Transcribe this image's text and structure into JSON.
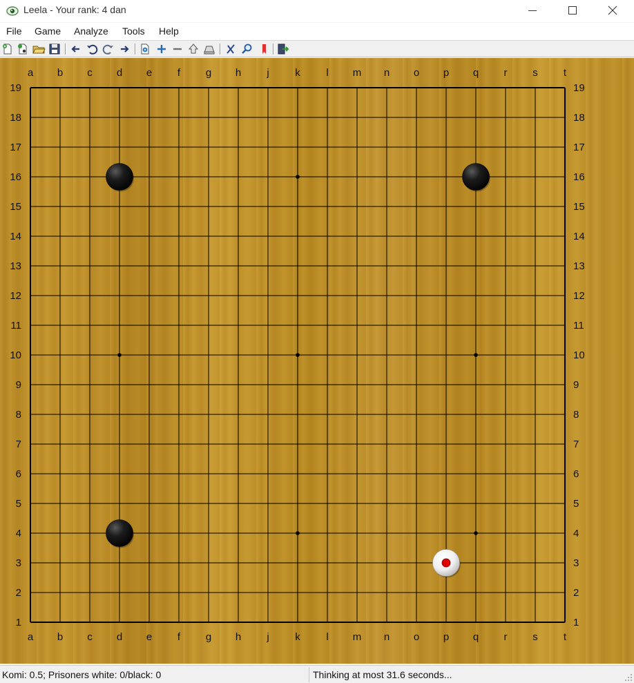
{
  "window": {
    "title": "Leela - Your rank: 4 dan",
    "icon": "leela-eye-icon"
  },
  "menu": [
    "File",
    "Game",
    "Analyze",
    "Tools",
    "Help"
  ],
  "toolbar": {
    "buttons": [
      "new-game",
      "new-rated-game",
      "open-file",
      "save-file",
      "back",
      "undo",
      "redo",
      "forward",
      "settings",
      "zoom-in",
      "zoom-out",
      "pass",
      "resign",
      "analyze",
      "find",
      "bookmark",
      "exit"
    ]
  },
  "board": {
    "size": 19,
    "columns": [
      "a",
      "b",
      "c",
      "d",
      "e",
      "f",
      "g",
      "h",
      "j",
      "k",
      "l",
      "m",
      "n",
      "o",
      "p",
      "q",
      "r",
      "s",
      "t"
    ],
    "rows": [
      "19",
      "18",
      "17",
      "16",
      "15",
      "14",
      "13",
      "12",
      "11",
      "10",
      "9",
      "8",
      "7",
      "6",
      "5",
      "4",
      "3",
      "2",
      "1"
    ],
    "hoshi": [
      "d16",
      "k16",
      "q16",
      "d10",
      "k10",
      "q10",
      "d4",
      "k4",
      "q4"
    ],
    "stones": [
      {
        "point": "d16",
        "color": "black"
      },
      {
        "point": "q16",
        "color": "black"
      },
      {
        "point": "d4",
        "color": "black"
      },
      {
        "point": "p3",
        "color": "white",
        "last_move": true
      }
    ],
    "last_move_marker_color": "#e00000"
  },
  "status": {
    "left": "Komi: 0.5; Prisoners white: 0/black: 0",
    "right": "Thinking at most 31.6 seconds..."
  }
}
